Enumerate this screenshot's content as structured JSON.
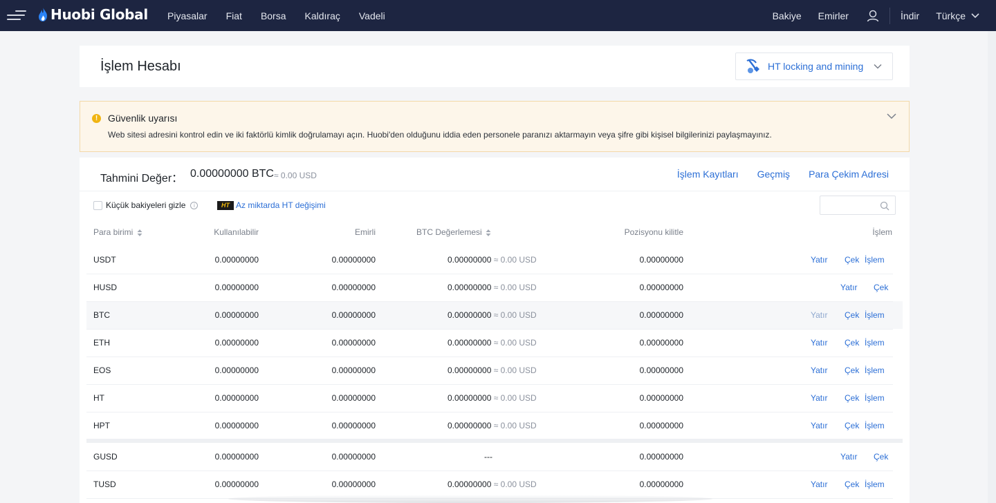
{
  "nav": {
    "logo": "Huobi Global",
    "left": [
      "Piyasalar",
      "Fiat",
      "Borsa",
      "Kaldıraç",
      "Vadeli"
    ],
    "balance": "Bakiye",
    "orders": "Emirler",
    "download": "İndir",
    "language": "Türkçe"
  },
  "header": {
    "title": "İşlem Hesabı",
    "dropdown_label": "HT locking and mining"
  },
  "alert": {
    "title": "Güvenlik uyarısı",
    "body": "Web sitesi adresini kontrol edin ve iki faktörlü kimlik doğrulamayı açın. Huobi'den olduğunu iddia eden personele paranızı aktarmayın veya şifre gibi kişisel bilgilerinizi paylaşmayınız."
  },
  "summary": {
    "label": "Tahmini Değer：",
    "value": "0.00000000 BTC",
    "usd": "≈ 0.00 USD",
    "links": [
      "İşlem Kayıtları",
      "Geçmiş",
      "Para Çekim Adresi"
    ]
  },
  "filters": {
    "hide_small": "Küçük bakiyeleri gizle",
    "info_glyph": "i",
    "ht_badge": "HT",
    "ht_swap": "Az miktarda HT değişimi",
    "search_placeholder": ""
  },
  "table": {
    "headers": {
      "currency": "Para birimi",
      "available": "Kullanılabilir",
      "frozen": "Emirli",
      "btc_value": "BTC Değerlemesi",
      "locked": "Pozisyonu kilitle",
      "action": "İşlem"
    },
    "actions": {
      "deposit": "Yatır",
      "withdraw": "Çek",
      "trade": "İşlem"
    },
    "rows": [
      {
        "coin": "USDT",
        "available": "0.00000000",
        "frozen": "0.00000000",
        "btc": "0.00000000",
        "usd": "≈ 0.00 USD",
        "locked": "0.00000000"
      },
      {
        "coin": "HUSD",
        "available": "0.00000000",
        "frozen": "0.00000000",
        "btc": "0.00000000",
        "usd": "≈ 0.00 USD",
        "locked": "0.00000000"
      },
      {
        "coin": "BTC",
        "available": "0.00000000",
        "frozen": "0.00000000",
        "btc": "0.00000000",
        "usd": "≈ 0.00 USD",
        "locked": "0.00000000"
      },
      {
        "coin": "ETH",
        "available": "0.00000000",
        "frozen": "0.00000000",
        "btc": "0.00000000",
        "usd": "≈ 0.00 USD",
        "locked": "0.00000000"
      },
      {
        "coin": "EOS",
        "available": "0.00000000",
        "frozen": "0.00000000",
        "btc": "0.00000000",
        "usd": "≈ 0.00 USD",
        "locked": "0.00000000"
      },
      {
        "coin": "HT",
        "available": "0.00000000",
        "frozen": "0.00000000",
        "btc": "0.00000000",
        "usd": "≈ 0.00 USD",
        "locked": "0.00000000"
      },
      {
        "coin": "HPT",
        "available": "0.00000000",
        "frozen": "0.00000000",
        "btc": "0.00000000",
        "usd": "≈ 0.00 USD",
        "locked": "0.00000000"
      },
      {
        "coin": "GUSD",
        "available": "0.00000000",
        "frozen": "0.00000000",
        "btc_dash": "---",
        "locked": "0.00000000"
      },
      {
        "coin": "TUSD",
        "available": "0.00000000",
        "frozen": "0.00000000",
        "btc": "0.00000000",
        "usd": "≈ 0.00 USD",
        "locked": "0.00000000"
      }
    ]
  },
  "colors": {
    "nav_bg": "#1d2541",
    "link": "#2c6fd6",
    "alert_bg": "#fdf6ea",
    "warning": "#f0b411"
  }
}
